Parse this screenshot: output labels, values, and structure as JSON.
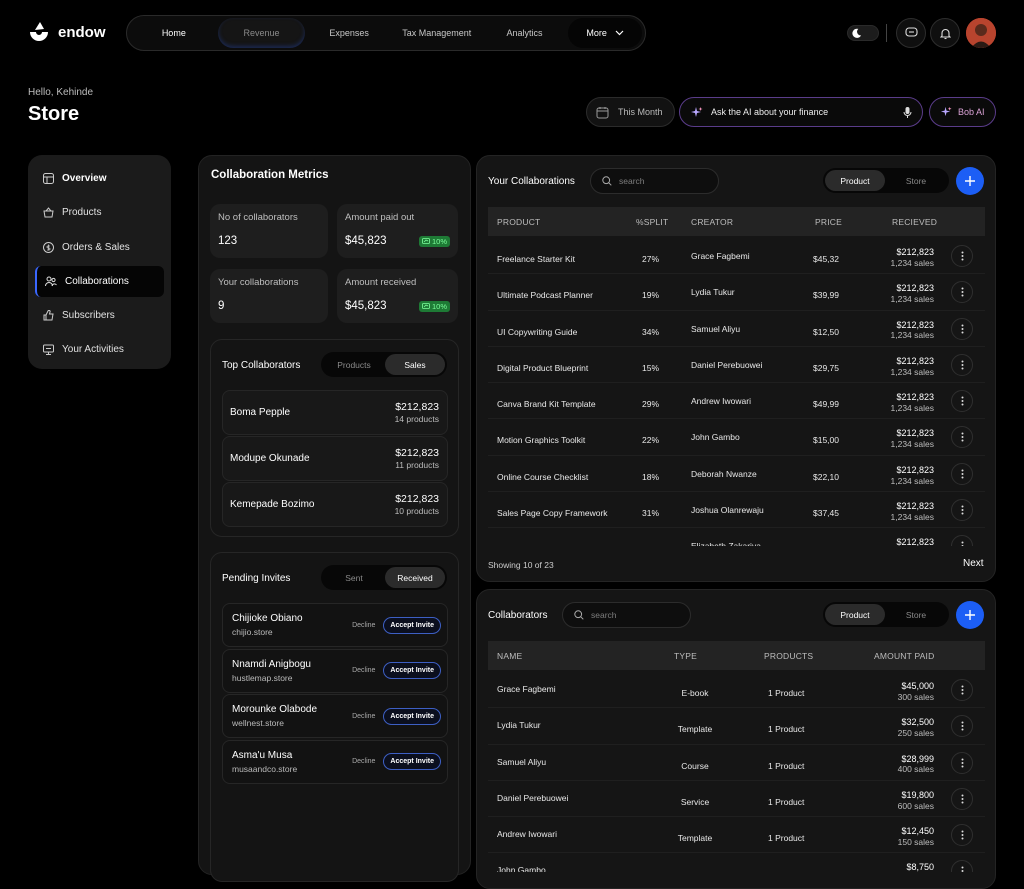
{
  "brand": {
    "name": "endow"
  },
  "nav": {
    "items": [
      "Home",
      "Revenue",
      "Expenses",
      "Tax Management",
      "Analytics"
    ],
    "more": "More"
  },
  "header": {
    "greeting": "Hello, Kehinde",
    "title": "Store",
    "period": "This Month",
    "ask_placeholder": "Ask the AI about your finance",
    "bob_label": "Bob AI"
  },
  "sidebar": {
    "items": [
      {
        "label": "Overview",
        "icon": "grid-icon"
      },
      {
        "label": "Products",
        "icon": "basket-icon"
      },
      {
        "label": "Orders & Sales",
        "icon": "dollar-icon"
      },
      {
        "label": "Collaborations",
        "icon": "users-icon"
      },
      {
        "label": "Subscribers",
        "icon": "thumbs-up-icon"
      },
      {
        "label": "Your Activities",
        "icon": "monitor-icon"
      }
    ]
  },
  "metrics": {
    "title": "Collaboration Metrics",
    "cards": [
      {
        "label": "No of collaborators",
        "value": "123",
        "badge": ""
      },
      {
        "label": "Amount paid out",
        "value": "$45,823",
        "badge": "10%"
      },
      {
        "label": "Your collaborations",
        "value": "9",
        "badge": ""
      },
      {
        "label": "Amount received",
        "value": "$45,823",
        "badge": "10%"
      }
    ]
  },
  "top_collaborators": {
    "title": "Top Collaborators",
    "tabs": [
      "Products",
      "Sales"
    ],
    "rows": [
      {
        "name": "Boma Pepple",
        "amount": "$212,823",
        "count": "14 products"
      },
      {
        "name": "Modupe Okunade",
        "amount": "$212,823",
        "count": "11 products"
      },
      {
        "name": "Kemepade Bozimo",
        "amount": "$212,823",
        "count": "10 products"
      }
    ]
  },
  "pending_invites": {
    "title": "Pending Invites",
    "tabs": [
      "Sent",
      "Received"
    ],
    "decline": "Decline",
    "accept": "Accept Invite",
    "rows": [
      {
        "name": "Chijioke Obiano",
        "store": "chijio.store"
      },
      {
        "name": "Nnamdi Anigbogu",
        "store": "hustlemap.store"
      },
      {
        "name": "Morounke Olabode",
        "store": "wellnest.store"
      },
      {
        "name": "Asma'u Musa",
        "store": "musaandco.store"
      }
    ]
  },
  "your_collabs": {
    "title": "Your Collaborations",
    "search": "search",
    "tabs": [
      "Product",
      "Store"
    ],
    "columns": [
      "PRODUCT",
      "%SPLIT",
      "CREATOR",
      "PRICE",
      "RECIEVED"
    ],
    "rows": [
      {
        "product": "Freelance Starter Kit",
        "split": "27%",
        "creator": "Grace Fagbemi",
        "price": "$45,32",
        "received": "$212,823",
        "sales": "1,234 sales"
      },
      {
        "product": "Ultimate Podcast Planner",
        "split": "19%",
        "creator": "Lydia Tukur",
        "price": "$39,99",
        "received": "$212,823",
        "sales": "1,234 sales"
      },
      {
        "product": "UI Copywriting Guide",
        "split": "34%",
        "creator": "Samuel Aliyu",
        "price": "$12,50",
        "received": "$212,823",
        "sales": "1,234 sales"
      },
      {
        "product": "Digital Product Blueprint",
        "split": "15%",
        "creator": "Daniel Perebuowei",
        "price": "$29,75",
        "received": "$212,823",
        "sales": "1,234 sales"
      },
      {
        "product": "Canva Brand Kit Template",
        "split": "29%",
        "creator": "Andrew Iwowari",
        "price": "$49,99",
        "received": "$212,823",
        "sales": "1,234 sales"
      },
      {
        "product": "Motion Graphics Toolkit",
        "split": "22%",
        "creator": "John Gambo",
        "price": "$15,00",
        "received": "$212,823",
        "sales": "1,234 sales"
      },
      {
        "product": "Online Course Checklist",
        "split": "18%",
        "creator": "Deborah Nwanze",
        "price": "$22,10",
        "received": "$212,823",
        "sales": "1,234 sales"
      },
      {
        "product": "Sales Page Copy Framework",
        "split": "31%",
        "creator": "Joshua Olanrewaju",
        "price": "$37,45",
        "received": "$212,823",
        "sales": "1,234 sales"
      },
      {
        "product": "",
        "split": "",
        "creator": "Elizabeth Zakariya",
        "price": "",
        "received": "$212,823",
        "sales": ""
      }
    ],
    "footer": "Showing 10 of 23",
    "next": "Next"
  },
  "collaborators": {
    "title": "Collaborators",
    "search": "search",
    "tabs": [
      "Product",
      "Store"
    ],
    "columns": [
      "NAME",
      "TYPE",
      "PRODUCTS",
      "AMOUNT PAID"
    ],
    "rows": [
      {
        "name": "Grace Fagbemi",
        "type": "E-book",
        "products": "1 Product",
        "amount": "$45,000",
        "sales": "300 sales"
      },
      {
        "name": "Lydia Tukur",
        "type": "Template",
        "products": "1 Product",
        "amount": "$32,500",
        "sales": "250 sales"
      },
      {
        "name": "Samuel Aliyu",
        "type": "Course",
        "products": "1 Product",
        "amount": "$28,999",
        "sales": "400 sales"
      },
      {
        "name": "Daniel Perebuowei",
        "type": "Service",
        "products": "1 Product",
        "amount": "$19,800",
        "sales": "600 sales"
      },
      {
        "name": "Andrew Iwowari",
        "type": "Template",
        "products": "1 Product",
        "amount": "$12,450",
        "sales": "150 sales"
      },
      {
        "name": "John Gambo",
        "type": "",
        "products": "",
        "amount": "$8,750",
        "sales": ""
      }
    ]
  },
  "colors": {
    "accent": "#1c5ef5",
    "positive": "#1e7a35"
  }
}
